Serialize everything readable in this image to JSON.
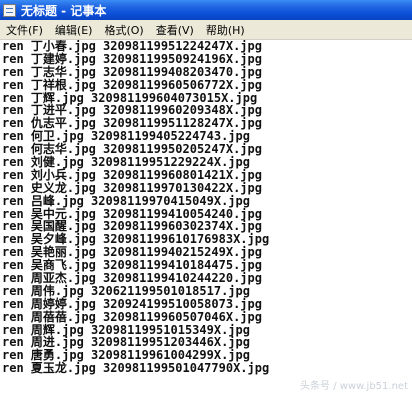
{
  "window": {
    "title": "无标题 - 记事本"
  },
  "menu": [
    "文件(F)",
    "编辑(E)",
    "格式(O)",
    "查看(V)",
    "帮助(H)"
  ],
  "lines": [
    "ren 丁小春.jpg 32098119951224247X.jpg",
    "ren 丁建婷.jpg 32098119950924196X.jpg",
    "ren 丁志华.jpg 320981199408203470.jpg",
    "ren 丁祥根.jpg 32098119960506772X.jpg",
    "ren 丁辉.jpg 320981199604073015X.jpg",
    "ren 丁进平.jpg 32098119960209348X.jpg",
    "ren 仇志平.jpg 32098119951128247X.jpg",
    "ren 何卫.jpg 320981199405224743.jpg",
    "ren 何志华.jpg 32098119950205247X.jpg",
    "ren 刘健.jpg 32098119951229224X.jpg",
    "ren 刘小兵.jpg 32098119960801421X.jpg",
    "ren 史义龙.jpg 32098119970130422X.jpg",
    "ren 吕峰.jpg 32098119970415049X.jpg",
    "ren 吴中元.jpg 320981199410054240.jpg",
    "ren 吴国醒.jpg 32098119960302374X.jpg",
    "ren 吴夕峰.jpg 320981199610176983X.jpg",
    "ren 吴艳丽.jpg 32098119940215249X.jpg",
    "ren 吴商飞.jpg 320981199410184475.jpg",
    "ren 周亚杰.jpg 320981199410244220.jpg",
    "ren 周伟.jpg 320621199501018517.jpg",
    "ren 周婷婷.jpg 320924199510058073.jpg",
    "ren 周蓓蓓.jpg 32098119960507046X.jpg",
    "ren 周辉.jpg 32098119951015349X.jpg",
    "ren 周进.jpg 32098119951203446X.jpg",
    "ren 唐勇.jpg 32098119961004299X.jpg",
    "ren 夏玉龙.jpg 320981199501047790X.jpg"
  ],
  "watermark": "头条号 / www.jb51.net"
}
